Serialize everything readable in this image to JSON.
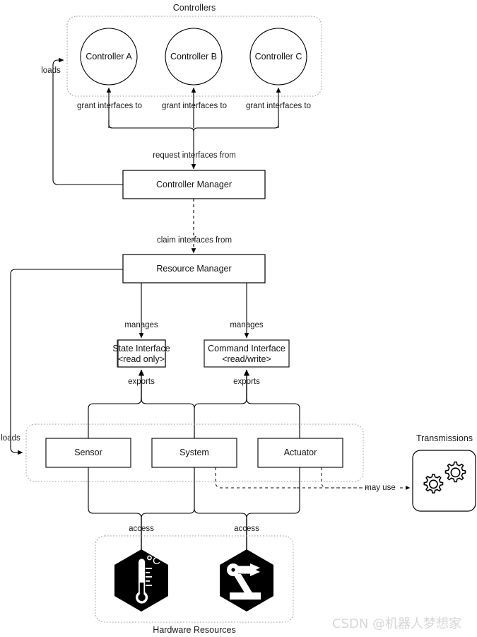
{
  "diagram": {
    "title_controllers": "Controllers",
    "title_hardware": "Hardware Resources",
    "title_transmissions": "Transmissions"
  },
  "nodes": {
    "controller_a": "Controller A",
    "controller_b": "Controller B",
    "controller_c": "Controller C",
    "controller_manager": "Controller Manager",
    "resource_manager": "Resource Manager",
    "state_interface_line1": "State Interface",
    "state_interface_line2": "<read only>",
    "command_interface_line1": "Command Interface",
    "command_interface_line2": "<read/write>",
    "sensor": "Sensor",
    "system": "System",
    "actuator": "Actuator"
  },
  "edge_labels": {
    "loads_top": "loads",
    "loads_bottom": "loads",
    "grant_a": "grant interfaces to",
    "grant_b": "grant interfaces to",
    "grant_c": "grant interfaces to",
    "request": "request interfaces from",
    "claim": "claim interfaces from",
    "manages_left": "manages",
    "manages_right": "manages",
    "exports_left": "exports",
    "exports_right": "exports",
    "access_left": "access",
    "access_right": "access",
    "may_use": "may use"
  },
  "icons": {
    "thermometer": "thermometer-celsius-icon",
    "robot_arm": "robot-arm-icon",
    "gears": "gears-icon"
  },
  "watermark": {
    "text": "CSDN @机器人梦想家"
  },
  "colors": {
    "stroke": "#000000",
    "container_stroke": "#9a9a9a",
    "text": "#111111",
    "watermark": "#d6d6d6",
    "background": "#ffffff",
    "hexagon_fill": "#000000"
  }
}
